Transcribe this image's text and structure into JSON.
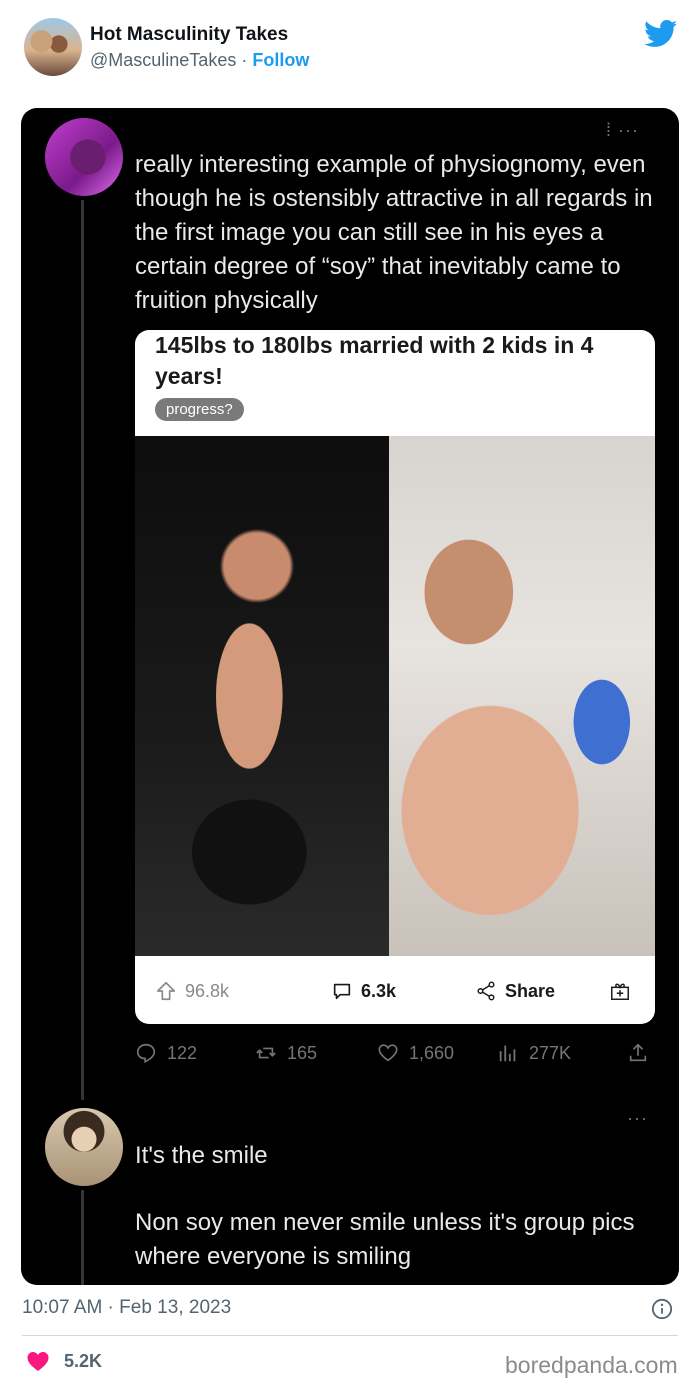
{
  "author": {
    "name": "Hot Masculinity Takes",
    "handle": "@MasculineTakes",
    "separator": "·",
    "follow": "Follow"
  },
  "reply1": {
    "text": "really interesting example of physiognomy, even though he is ostensibly attractive in all regards in the first image you can still see in his eyes a certain degree of “soy” that inevitably came to fruition physically"
  },
  "reddit": {
    "title": "145lbs to 180lbs married with 2 kids in 4 years!",
    "flair": "progress?",
    "upvotes": "96.8k",
    "comments": "6.3k",
    "share": "Share"
  },
  "stats": {
    "replies": "122",
    "retweets": "165",
    "likes": "1,660",
    "views": "277K"
  },
  "reply2": {
    "line1": "It's the smile",
    "line2": "Non soy men never smile unless it's group pics where everyone is smiling"
  },
  "footer": {
    "timestamp": "10:07 AM · Feb 13, 2023",
    "likes": "5.2K",
    "watermark": "boredpanda.com"
  },
  "colors": {
    "twitter_blue": "#1d9bf0",
    "heart": "#f91880",
    "card_bg": "#000000"
  }
}
